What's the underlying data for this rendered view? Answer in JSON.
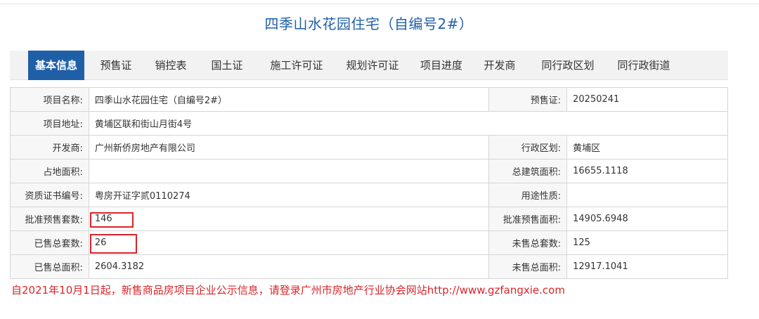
{
  "page": {
    "title": "四季山水花园住宅（自编号2#）"
  },
  "tabs": [
    {
      "label": "基本信息",
      "active": true
    },
    {
      "label": "预售证",
      "active": false
    },
    {
      "label": "销控表",
      "active": false
    },
    {
      "label": "国土证",
      "active": false
    },
    {
      "label": "施工许可证",
      "active": false
    },
    {
      "label": "规划许可证",
      "active": false
    },
    {
      "label": "项目进度",
      "active": false
    },
    {
      "label": "开发商",
      "active": false
    },
    {
      "label": "同行政区划",
      "active": false
    },
    {
      "label": "同行政街道",
      "active": false
    }
  ],
  "info": {
    "project_name_label": "项目名称:",
    "project_name": "四季山水花园住宅（自编号2#）",
    "presale_cert_label": "预售证:",
    "presale_cert": "20250241",
    "address_label": "项目地址:",
    "address": "黄埔区联和街山月街4号",
    "developer_label": "开发商:",
    "developer": "广州新侨房地产有限公司",
    "district_label": "行政区划:",
    "district": "黄埔区",
    "land_area_label": "占地面积:",
    "land_area": "",
    "total_building_area_label": "总建筑面积:",
    "total_building_area": "16655.1118",
    "qualification_no_label": "资质证书编号:",
    "qualification_no": "粤房开证字贰0110274",
    "usage_label": "用途性质:",
    "usage": "",
    "approved_units_label": "批准预售套数:",
    "approved_units": "146",
    "approved_area_label": "批准预售面积:",
    "approved_area": "14905.6948",
    "sold_units_label": "已售总套数:",
    "sold_units": "26",
    "unsold_units_label": "未售总套数:",
    "unsold_units": "125",
    "sold_area_label": "已售总面积:",
    "sold_area": "2604.3182",
    "unsold_area_label": "未售总面积:",
    "unsold_area": "12917.1041"
  },
  "notice": "自2021年10月1日起，新售商品房项目企业公示信息，请登录广州市房地产行业协会网站http://www.gzfangxie.com",
  "colors": {
    "accent": "#1f5fa8",
    "highlight": "#d9242a"
  }
}
